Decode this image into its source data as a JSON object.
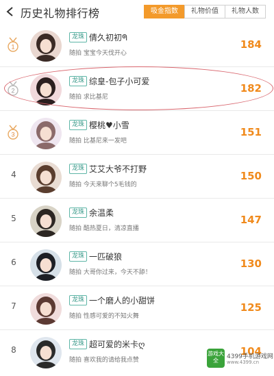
{
  "header": {
    "title": "历史礼物排行榜",
    "tabs": [
      {
        "label": "吸金指数",
        "active": true
      },
      {
        "label": "礼物价值",
        "active": false
      },
      {
        "label": "礼物人数",
        "active": false
      }
    ]
  },
  "colors": {
    "accent": "#f39a2b",
    "value": "#f08a1c",
    "badge": "#3a9a8a",
    "highlight_circle": "#d9666e"
  },
  "ranking": [
    {
      "rank": "1",
      "medal": true,
      "badge": "龙珠",
      "nickname": "倩久初初ᖗ",
      "desc": "随拍 宝宝今天伐开心",
      "value": "184"
    },
    {
      "rank": "2",
      "medal": true,
      "badge": "龙珠",
      "nickname": "综皇-包子小可爱",
      "desc": "随拍 求比基尼",
      "value": "182"
    },
    {
      "rank": "3",
      "medal": true,
      "badge": "龙珠",
      "nickname": "樱桃♥小雪",
      "desc": "随拍 比基尼来一发吧",
      "value": "151"
    },
    {
      "rank": "4",
      "medal": false,
      "badge": "龙珠",
      "nickname": "艾艾大爷不打野",
      "desc": "随拍 今天来聊个5毛钱的",
      "value": "150"
    },
    {
      "rank": "5",
      "medal": false,
      "badge": "龙珠",
      "nickname": "余温柔",
      "desc": "随拍 酷热夏日，清凉直播",
      "value": "147"
    },
    {
      "rank": "6",
      "medal": false,
      "badge": "龙珠",
      "nickname": "一匹破狼",
      "desc": "随拍 大哥你过来，今天不舔！",
      "value": "130"
    },
    {
      "rank": "7",
      "medal": false,
      "badge": "龙珠",
      "nickname": "一个磨人的小甜饼",
      "desc": "随拍 性感可爱的不知火舞",
      "value": "125"
    },
    {
      "rank": "8",
      "medal": false,
      "badge": "龙珠",
      "nickname": "超可爱的米卡ღ",
      "desc": "随拍 喜欢我的请给我点赞",
      "value": "104"
    }
  ],
  "watermark": {
    "logo_text": "游戏大全",
    "site": "4399手机游戏网",
    "url": "www.4399.cn"
  }
}
